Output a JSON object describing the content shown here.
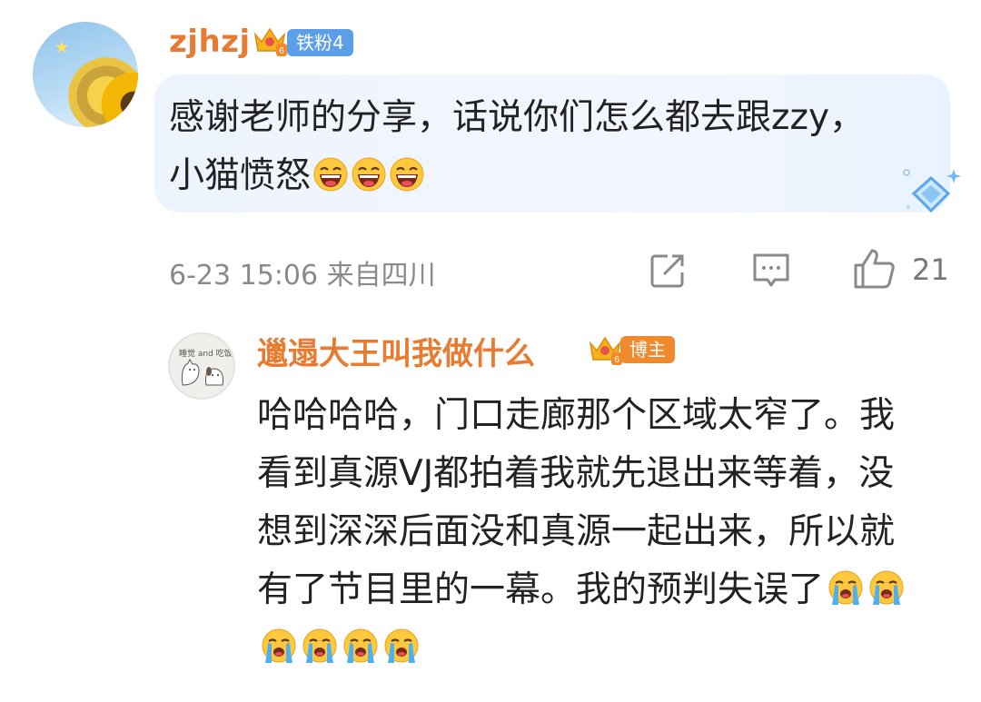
{
  "comment": {
    "username": "zjhzj",
    "fan_badge": "铁粉4",
    "text": "感谢老师的分享，话说你们怎么都去跟zzy，小猫愤怒",
    "laugh_emoji_count": 3,
    "time": "6-23 15:06",
    "location": "来自四川",
    "like_count": "21"
  },
  "reply": {
    "username": "邋遢大王叫我做什么",
    "role_badge": "博主",
    "avatar_caption": "睡觉 and 吃饭",
    "text": "哈哈哈哈，门口走廊那个区域太窄了。我看到真源VJ都拍着我就先退出来等着，没想到深深后面没和真源一起出来，所以就有了节目里的一幕。我的预判失误了",
    "cry_emoji_count": 6
  },
  "icons": {
    "share": "share-icon",
    "comment": "comment-icon",
    "like": "thumbs-up-icon",
    "crown": "crown-icon",
    "gem": "diamond-icon"
  },
  "colors": {
    "username": "#e87b32",
    "fan_badge": "#5c9ee8",
    "blogger_badge": "#f08a2c",
    "meta": "#8a8a8a",
    "bubble": "#eef4fd"
  }
}
